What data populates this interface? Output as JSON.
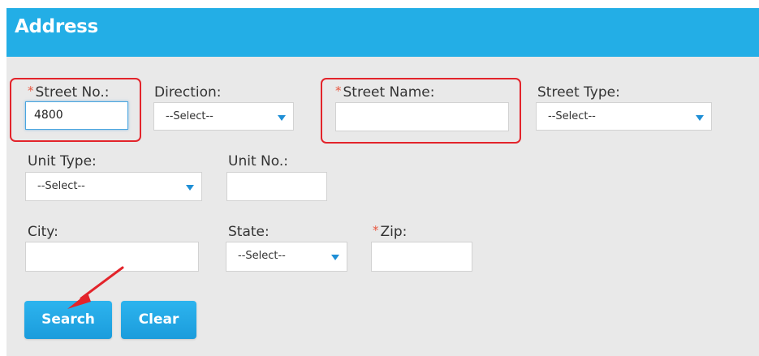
{
  "section": {
    "title": "Address"
  },
  "fields": {
    "street_no": {
      "label": "Street No.:",
      "required_mark": "*",
      "value": "4800"
    },
    "direction": {
      "label": "Direction:",
      "selected": "--Select--"
    },
    "street_name": {
      "label": "Street Name:",
      "required_mark": "*",
      "value": ""
    },
    "street_type": {
      "label": "Street Type:",
      "selected": "--Select--"
    },
    "unit_type": {
      "label": "Unit Type:",
      "selected": "--Select--"
    },
    "unit_no": {
      "label": "Unit No.:",
      "value": ""
    },
    "city": {
      "label": "City:",
      "value": ""
    },
    "state": {
      "label": "State:",
      "selected": "--Select--"
    },
    "zip": {
      "label": "Zip:",
      "required_mark": "*",
      "value": ""
    }
  },
  "buttons": {
    "search": "Search",
    "clear": "Clear"
  },
  "colors": {
    "header": "#23aee6",
    "panel": "#e9e9e9",
    "highlight": "#e3242b",
    "button": "#1ea6e3",
    "caret": "#1f8fd6",
    "required": "#e8563f"
  },
  "icons": {
    "dropdown": "caret-down-icon",
    "annotation": "red-arrow-icon"
  }
}
